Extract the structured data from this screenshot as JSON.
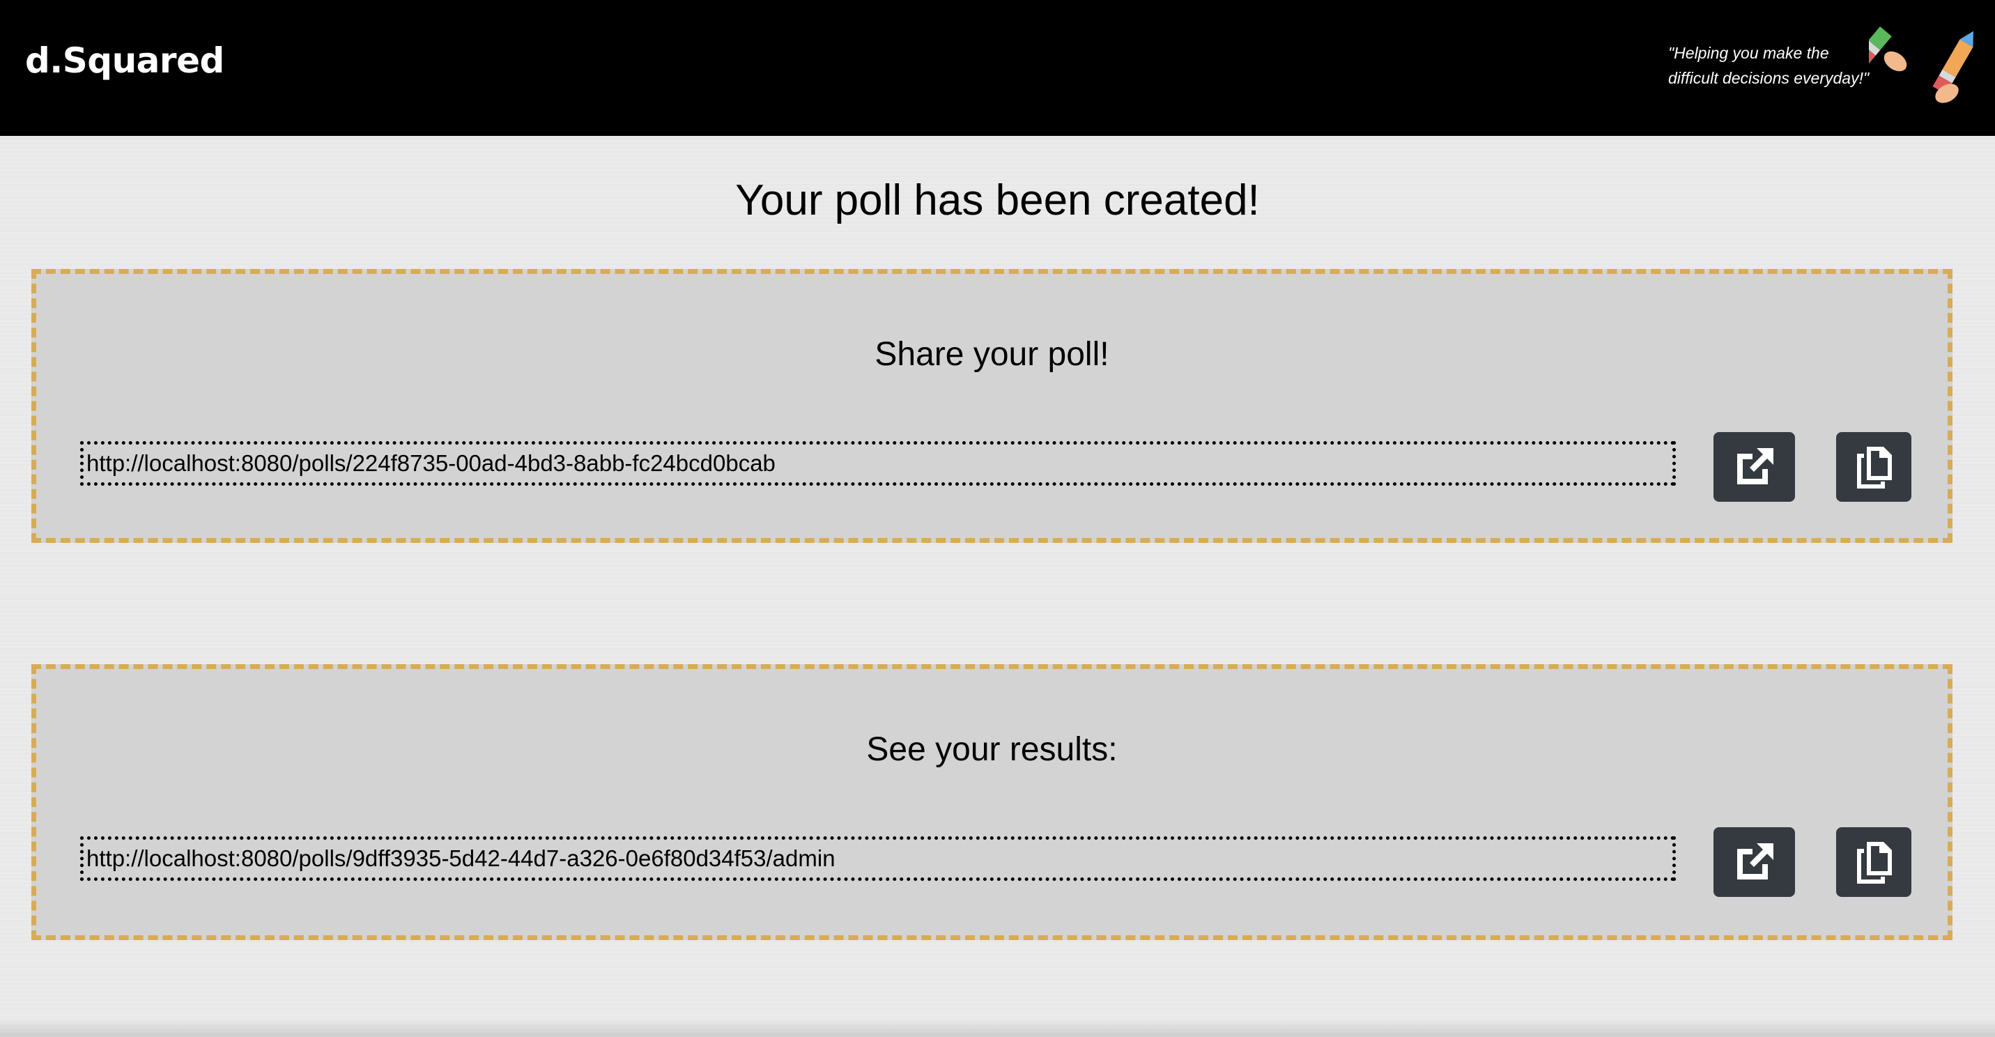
{
  "navbar": {
    "brand": "d.Squared",
    "tagline_line1": "\"Helping you make the",
    "tagline_line2": "difficult decisions everyday!\"",
    "logo_icon": "pencils-logo-icon"
  },
  "main": {
    "title": "Your poll has been created!"
  },
  "share_card": {
    "title": "Share your poll!",
    "url": "http://localhost:8080/polls/224f8735-00ad-4bd3-8abb-fc24bcd0bcab",
    "open_icon": "external-link-icon",
    "copy_icon": "copy-icon"
  },
  "results_card": {
    "title": "See your results:",
    "url": "http://localhost:8080/polls/9dff3935-5d42-44d7-a326-0e6f80d34f53/admin",
    "open_icon": "external-link-icon",
    "copy_icon": "copy-icon"
  },
  "colors": {
    "navbar_bg": "#000000",
    "card_bg": "#d3d3d3",
    "card_border": "#d8ab55",
    "button_bg": "#343a40"
  }
}
